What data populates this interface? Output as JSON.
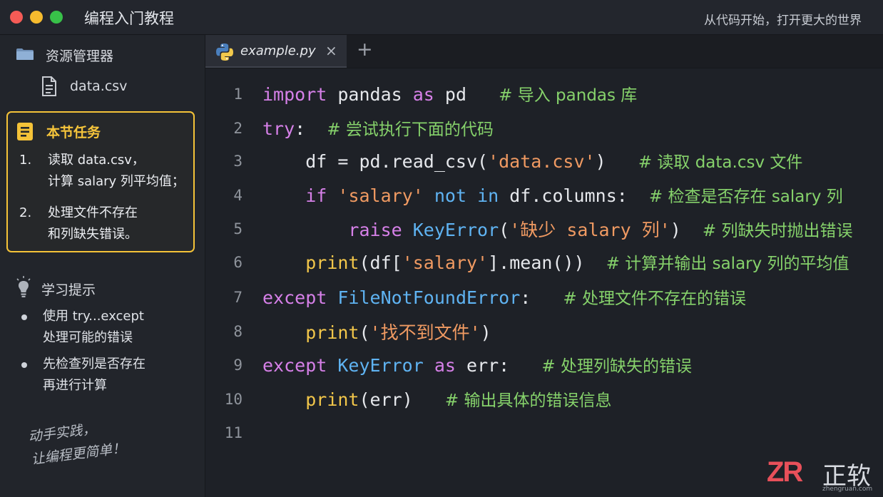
{
  "window": {
    "title": "编程入门教程",
    "slogan": "从代码开始，打开更大的世界"
  },
  "sidebar": {
    "explorer_title": "资源管理器",
    "file": "data.csv",
    "task": {
      "title": "本节任务",
      "items": [
        {
          "num": "1.",
          "lines": [
            "读取 data.csv，",
            "计算 salary 列平均值；"
          ]
        },
        {
          "num": "2.",
          "lines": [
            "处理文件不存在",
            "和列缺失错误。"
          ]
        }
      ]
    },
    "tips": {
      "title": "学习提示",
      "items": [
        {
          "lines": [
            "使用 try...except",
            "处理可能的错误"
          ]
        },
        {
          "lines": [
            "先检查列是否存在",
            "再进行计算"
          ]
        }
      ]
    },
    "handwritten": [
      "动手实践，",
      "让编程更简单！"
    ]
  },
  "editor": {
    "tab_label": "example.py",
    "tab_close": "×",
    "tab_add": "+",
    "lines": [
      {
        "n": "1",
        "tokens": [
          [
            "kw",
            "import"
          ],
          [
            "pl",
            " pandas "
          ],
          [
            "kw",
            "as"
          ],
          [
            "pl",
            " pd   "
          ],
          [
            "cm",
            "# 导入 pandas 库"
          ]
        ]
      },
      {
        "n": "2",
        "tokens": [
          [
            "kw",
            "try"
          ],
          [
            "pl",
            ":  "
          ],
          [
            "cm",
            "# 尝试执行下面的代码"
          ]
        ]
      },
      {
        "n": "3",
        "tokens": [
          [
            "pl",
            "    df = pd.read_csv("
          ],
          [
            "str",
            "'data.csv'"
          ],
          [
            "pl",
            ")   "
          ],
          [
            "cm",
            "# 读取 data.csv 文件"
          ]
        ]
      },
      {
        "n": "4",
        "tokens": [
          [
            "pl",
            "    "
          ],
          [
            "kw",
            "if"
          ],
          [
            "pl",
            " "
          ],
          [
            "str",
            "'salary'"
          ],
          [
            "pl",
            " "
          ],
          [
            "cls",
            "not"
          ],
          [
            "pl",
            " "
          ],
          [
            "cls",
            "in"
          ],
          [
            "pl",
            " df.columns:  "
          ],
          [
            "cm",
            "# 检查是否存在 salary 列"
          ]
        ]
      },
      {
        "n": "5",
        "tokens": [
          [
            "pl",
            "        "
          ],
          [
            "kw",
            "raise"
          ],
          [
            "pl",
            " "
          ],
          [
            "cls",
            "KeyError"
          ],
          [
            "pl",
            "("
          ],
          [
            "str",
            "'缺少 salary 列'"
          ],
          [
            "pl",
            ")  "
          ],
          [
            "cm",
            "# 列缺失时抛出错误"
          ]
        ]
      },
      {
        "n": "6",
        "tokens": [
          [
            "pl",
            "    "
          ],
          [
            "fn",
            "print"
          ],
          [
            "pl",
            "(df["
          ],
          [
            "str",
            "'salary'"
          ],
          [
            "pl",
            "].mean())  "
          ],
          [
            "cm",
            "# 计算并输出 salary 列的平均值"
          ]
        ]
      },
      {
        "n": "7",
        "tokens": [
          [
            "kw",
            "except"
          ],
          [
            "pl",
            " "
          ],
          [
            "cls",
            "FileNotFoundError"
          ],
          [
            "pl",
            ":   "
          ],
          [
            "cm",
            "# 处理文件不存在的错误"
          ]
        ]
      },
      {
        "n": "8",
        "tokens": [
          [
            "pl",
            "    "
          ],
          [
            "fn",
            "print"
          ],
          [
            "pl",
            "("
          ],
          [
            "str",
            "'找不到文件'"
          ],
          [
            "pl",
            ")"
          ]
        ]
      },
      {
        "n": "9",
        "tokens": [
          [
            "kw",
            "except"
          ],
          [
            "pl",
            " "
          ],
          [
            "cls",
            "KeyError"
          ],
          [
            "pl",
            " "
          ],
          [
            "kw",
            "as"
          ],
          [
            "pl",
            " err:   "
          ],
          [
            "cm",
            "# 处理列缺失的错误"
          ]
        ]
      },
      {
        "n": "10",
        "tokens": [
          [
            "pl",
            "    "
          ],
          [
            "fn",
            "print"
          ],
          [
            "pl",
            "(err)   "
          ],
          [
            "cm",
            "# 输出具体的错误信息"
          ]
        ]
      },
      {
        "n": "11",
        "tokens": []
      }
    ]
  },
  "logo": {
    "mark": "ZR",
    "name": "正软",
    "url": "zhengruan.com"
  },
  "colors": {
    "keyword": "#d680e8",
    "string": "#f09a62",
    "function": "#f2c64a",
    "class": "#5fb3f2",
    "comment": "#86d26b",
    "task_border": "#f5c338",
    "logo_red": "#e8505a"
  }
}
